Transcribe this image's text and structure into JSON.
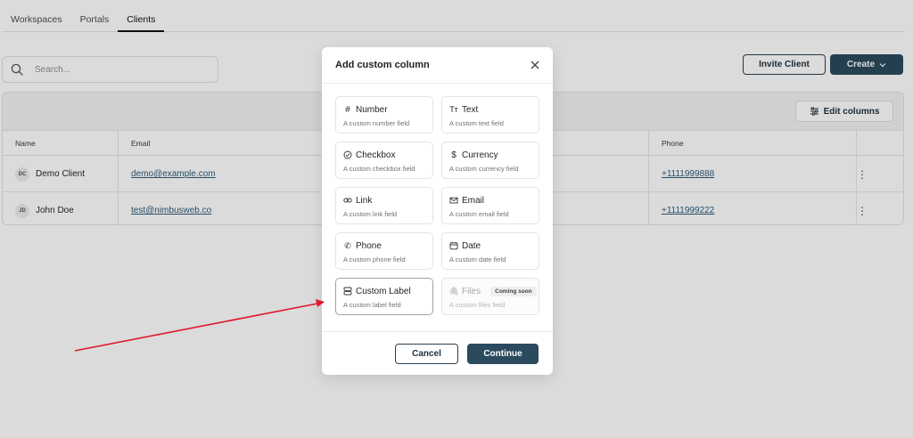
{
  "tabs": [
    "Workspaces",
    "Portals",
    "Clients"
  ],
  "active_tab": "Clients",
  "search": {
    "placeholder": "Search..."
  },
  "actions": {
    "invite_label": "Invite Client",
    "create_label": "Create"
  },
  "table": {
    "edit_columns_label": "Edit columns",
    "columns": [
      "Name",
      "Email",
      "Phone"
    ],
    "rows": [
      {
        "initials": "DC",
        "name": "Demo Client",
        "email": "demo@example.com",
        "phone": "+1111999888"
      },
      {
        "initials": "JD",
        "name": "John Doe",
        "email": "test@nimbusweb.co",
        "phone": "+1111999222"
      }
    ]
  },
  "modal": {
    "title": "Add custom column",
    "options": [
      {
        "icon": "hash-icon",
        "label": "Number",
        "desc": "A custom number field"
      },
      {
        "icon": "text-icon",
        "label": "Text",
        "desc": "A custom text field"
      },
      {
        "icon": "checkbox-icon",
        "label": "Checkbox",
        "desc": "A custom checkbox field"
      },
      {
        "icon": "dollar-icon",
        "label": "Currency",
        "desc": "A custom currency field"
      },
      {
        "icon": "link-icon",
        "label": "Link",
        "desc": "A custom link field"
      },
      {
        "icon": "mail-icon",
        "label": "Email",
        "desc": "A custom email field"
      },
      {
        "icon": "phone-icon",
        "label": "Phone",
        "desc": "A custom phone field"
      },
      {
        "icon": "calendar-icon",
        "label": "Date",
        "desc": "A custom date field"
      },
      {
        "icon": "label-icon",
        "label": "Custom Label",
        "desc": "A custom label field"
      },
      {
        "icon": "paperclip-icon",
        "label": "Files",
        "desc": "A custom files field",
        "badge": "Coming soon"
      }
    ],
    "cancel_label": "Cancel",
    "continue_label": "Continue"
  },
  "colors": {
    "primary": "#2b4a5e",
    "annotation_arrow": "#e0182d"
  }
}
